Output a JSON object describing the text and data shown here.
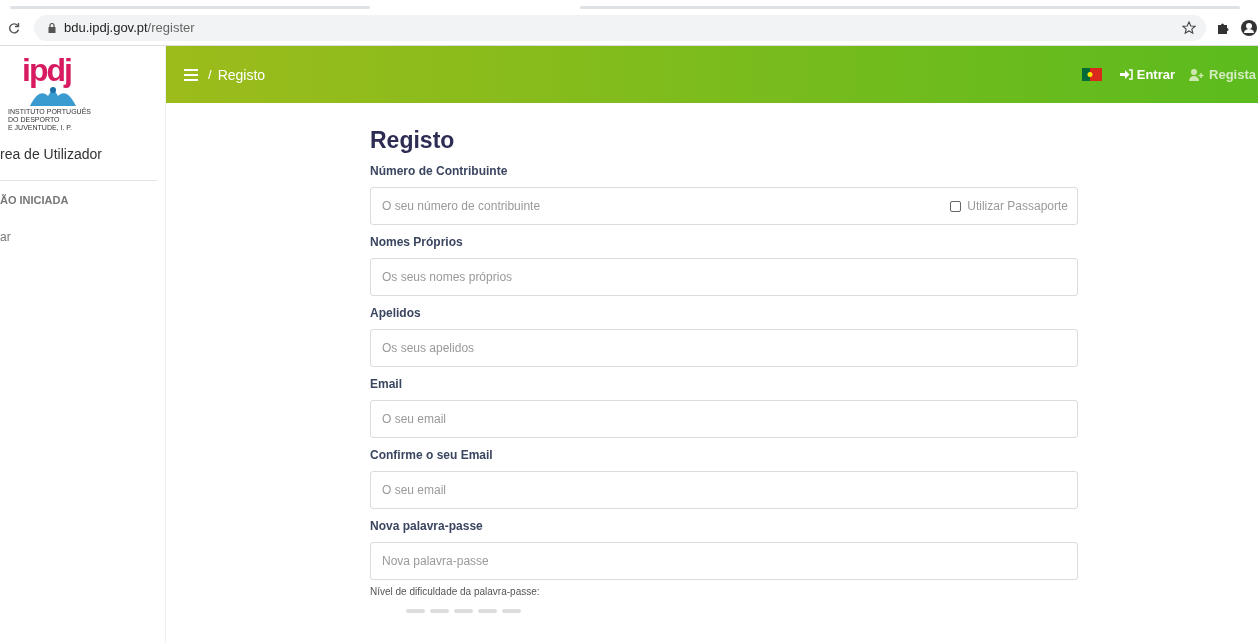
{
  "browser": {
    "url_host": "bdu.ipdj.gov.pt",
    "url_path": "/register"
  },
  "sidebar": {
    "logo_text": "ipdj",
    "logo_lines": [
      "INSTITUTO PORTUGUÊS",
      "DO DESPORTO",
      "E JUVENTUDE, I. P."
    ],
    "title": "rea de Utilizador",
    "section": "ÃO INICIADA",
    "items": [
      "ar"
    ]
  },
  "header": {
    "breadcrumb_separator": "/",
    "breadcrumb": "Registo",
    "actions": [
      {
        "label": "Entrar",
        "kind": "login"
      },
      {
        "label": "Regista",
        "kind": "register"
      }
    ]
  },
  "form": {
    "title": "Registo",
    "fields": [
      {
        "label": "Número de Contribuinte",
        "placeholder": "O seu número de contribuinte",
        "checkbox": {
          "label": "Utilizar Passaporte",
          "checked": false
        }
      },
      {
        "label": "Nomes Próprios",
        "placeholder": "Os seus nomes próprios"
      },
      {
        "label": "Apelidos",
        "placeholder": "Os seus apelidos"
      },
      {
        "label": "Email",
        "placeholder": "O seu email"
      },
      {
        "label": "Confirme o seu Email",
        "placeholder": "O seu email"
      },
      {
        "label": "Nova palavra-passe",
        "placeholder": "Nova palavra-passe"
      }
    ],
    "strength_label": "Nível de dificuldade da palavra-passe:",
    "strength_segments": [
      {
        "on": false
      },
      {
        "on": false
      },
      {
        "on": false
      },
      {
        "on": false
      },
      {
        "on": false
      }
    ]
  }
}
